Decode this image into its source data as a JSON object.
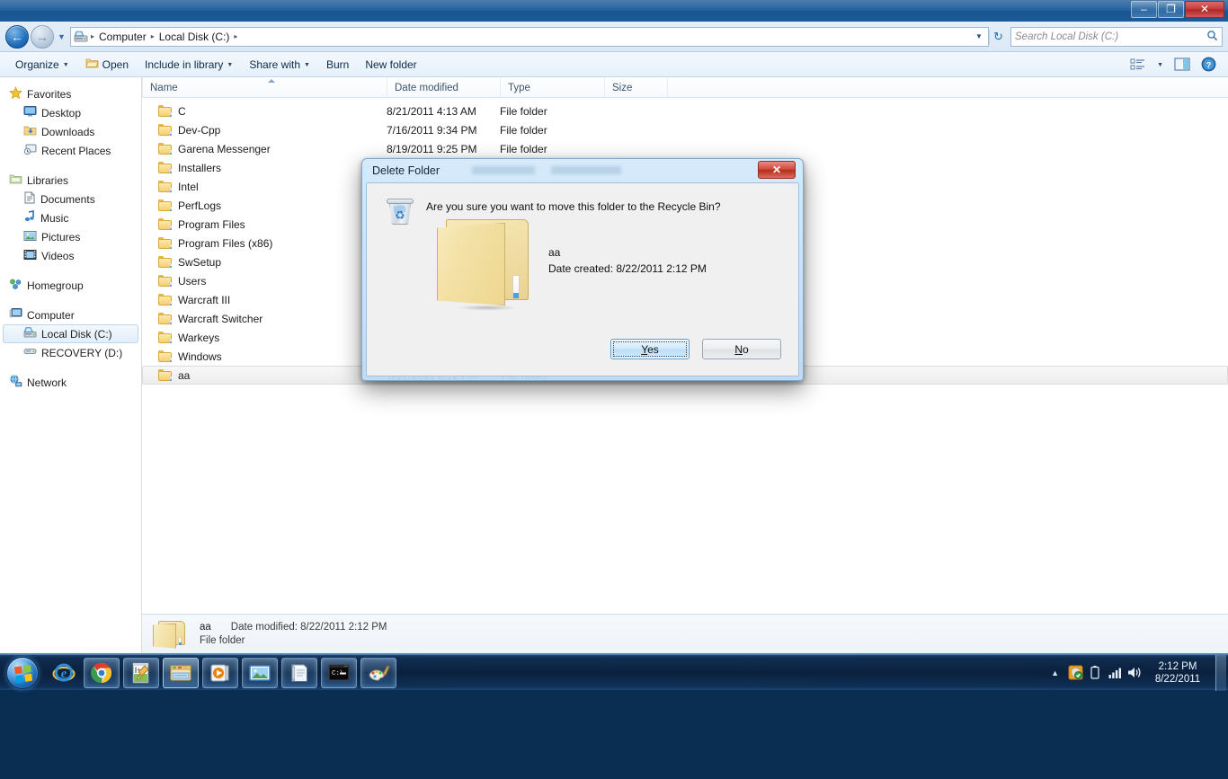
{
  "window": {
    "minimize_label": "–",
    "maximize_label": "❐",
    "close_label": "✕"
  },
  "address_bar": {
    "back_label": "←",
    "forward_label": "→",
    "history_label": "▼",
    "computer_icon": "computer-drive-icon",
    "crumbs": [
      "Computer",
      "Local Disk (C:)"
    ],
    "separator": "▸",
    "dropdown_label": "▼",
    "refresh_label": "↻"
  },
  "search": {
    "placeholder": "Search Local Disk (C:)",
    "icon": "🔍"
  },
  "command_bar": {
    "items": [
      {
        "label": "Organize",
        "has_caret": true,
        "has_icon": false
      },
      {
        "label": "Open",
        "has_caret": false,
        "has_icon": true
      },
      {
        "label": "Include in library",
        "has_caret": true,
        "has_icon": false
      },
      {
        "label": "Share with",
        "has_caret": true,
        "has_icon": false
      },
      {
        "label": "Burn",
        "has_caret": false,
        "has_icon": false
      },
      {
        "label": "New folder",
        "has_caret": false,
        "has_icon": false
      }
    ],
    "caret": "▼",
    "view_icon": "view-layout-icon",
    "view_caret": "▼",
    "preview_icon": "preview-pane-icon",
    "help_icon": "help-icon",
    "help_glyph": "?"
  },
  "nav_pane": {
    "groups": [
      {
        "header": {
          "label": "Favorites",
          "icon": "star-icon"
        },
        "items": [
          {
            "label": "Desktop",
            "icon": "desktop-icon"
          },
          {
            "label": "Downloads",
            "icon": "downloads-icon"
          },
          {
            "label": "Recent Places",
            "icon": "recent-places-icon"
          }
        ]
      },
      {
        "header": {
          "label": "Libraries",
          "icon": "libraries-icon"
        },
        "items": [
          {
            "label": "Documents",
            "icon": "document-icon"
          },
          {
            "label": "Music",
            "icon": "music-note-icon"
          },
          {
            "label": "Pictures",
            "icon": "picture-icon"
          },
          {
            "label": "Videos",
            "icon": "video-icon"
          }
        ]
      },
      {
        "header": {
          "label": "Homegroup",
          "icon": "homegroup-icon"
        },
        "items": []
      },
      {
        "header": {
          "label": "Computer",
          "icon": "computer-icon"
        },
        "items": [
          {
            "label": "Local Disk (C:)",
            "icon": "hard-drive-icon",
            "selected": true
          },
          {
            "label": "RECOVERY (D:)",
            "icon": "drive-icon",
            "selected": false
          }
        ]
      },
      {
        "header": {
          "label": "Network",
          "icon": "network-icon"
        },
        "items": []
      }
    ]
  },
  "file_list": {
    "columns": [
      "Name",
      "Date modified",
      "Type",
      "Size"
    ],
    "sort_column": "Name",
    "sort_direction": "ascending",
    "rows": [
      {
        "name": "C",
        "date": "8/21/2011 4:13 AM",
        "type": "File folder",
        "size": "",
        "selected": false
      },
      {
        "name": "Dev-Cpp",
        "date": "7/16/2011 9:34 PM",
        "type": "File folder",
        "size": "",
        "selected": false
      },
      {
        "name": "Garena Messenger",
        "date": "8/19/2011 9:25 PM",
        "type": "File folder",
        "size": "",
        "selected": false
      },
      {
        "name": "Installers",
        "date": "",
        "type": "",
        "size": "",
        "selected": false
      },
      {
        "name": "Intel",
        "date": "",
        "type": "",
        "size": "",
        "selected": false
      },
      {
        "name": "PerfLogs",
        "date": "",
        "type": "",
        "size": "",
        "selected": false
      },
      {
        "name": "Program Files",
        "date": "",
        "type": "",
        "size": "",
        "selected": false
      },
      {
        "name": "Program Files (x86)",
        "date": "",
        "type": "",
        "size": "",
        "selected": false
      },
      {
        "name": "SwSetup",
        "date": "",
        "type": "",
        "size": "",
        "selected": false
      },
      {
        "name": "Users",
        "date": "",
        "type": "",
        "size": "",
        "selected": false
      },
      {
        "name": "Warcraft III",
        "date": "",
        "type": "",
        "size": "",
        "selected": false
      },
      {
        "name": "Warcraft Switcher",
        "date": "",
        "type": "",
        "size": "",
        "selected": false
      },
      {
        "name": "Warkeys",
        "date": "",
        "type": "",
        "size": "",
        "selected": false
      },
      {
        "name": "Windows",
        "date": "",
        "type": "",
        "size": "",
        "selected": false
      },
      {
        "name": "aa",
        "date": "8/22/2011 2:12 PM",
        "type": "File folder",
        "size": "",
        "selected": true
      }
    ]
  },
  "details_pane": {
    "icon": "folder-icon",
    "name": "aa",
    "date_label": "Date modified:",
    "date_value": "8/22/2011 2:12 PM",
    "type": "File folder"
  },
  "dialog": {
    "title": "Delete Folder",
    "close_label": "✕",
    "icon": "recycle-bin-icon",
    "preview_icon": "folder-icon-large",
    "question": "Are you sure you want to move this folder to the Recycle Bin?",
    "item_name": "aa",
    "item_date": "Date created: 8/22/2011 2:12 PM",
    "buttons": [
      {
        "label": "Yes",
        "mnemonic": "Y",
        "rest": "es",
        "default": true
      },
      {
        "label": "No",
        "mnemonic": "N",
        "rest": "o",
        "default": false
      }
    ]
  },
  "taskbar": {
    "start_label": "start-orb",
    "items": [
      {
        "name": "internet-explorer-icon",
        "state": "pinned"
      },
      {
        "name": "google-chrome-icon",
        "state": "open"
      },
      {
        "name": "dev-cpp-icon",
        "state": "open"
      },
      {
        "name": "windows-explorer-icon",
        "state": "active"
      },
      {
        "name": "media-player-icon",
        "state": "open"
      },
      {
        "name": "photo-viewer-icon",
        "state": "open"
      },
      {
        "name": "notepad-icon",
        "state": "open"
      },
      {
        "name": "command-prompt-icon",
        "state": "open"
      },
      {
        "name": "paint-icon",
        "state": "open"
      }
    ],
    "tray": {
      "chevron": "▲",
      "icons": [
        "security-shield-icon",
        "battery-icon",
        "network-signal-icon",
        "volume-icon"
      ],
      "time": "2:12 PM",
      "date": "8/22/2011"
    }
  },
  "colors": {
    "accent": "#1f6fbc",
    "titlebar": "#1a558f",
    "close_red": "#c93b3b",
    "folder_yellow": "#f6cf71",
    "selection": "#ededed"
  }
}
